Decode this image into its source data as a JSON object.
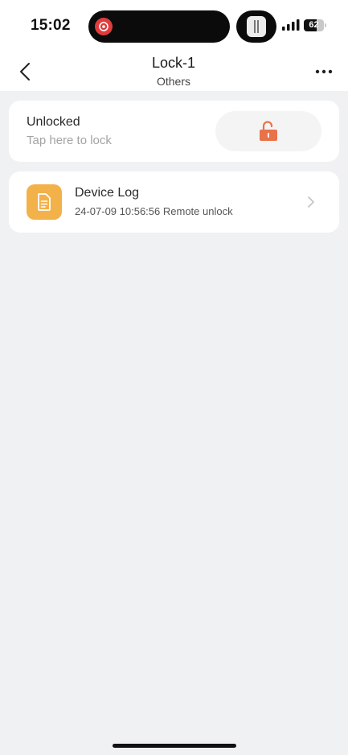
{
  "status_bar": {
    "time": "15:02",
    "battery_level": "62",
    "battery_fraction": 0.62
  },
  "header": {
    "title": "Lock-1",
    "subtitle": "Others"
  },
  "lock_card": {
    "status": "Unlocked",
    "hint": "Tap here to lock",
    "icon": "unlocked-padlock-icon",
    "icon_color": "#e8734a"
  },
  "device_log": {
    "title": "Device Log",
    "latest_entry": "24-07-09 10:56:56 Remote unlock",
    "icon": "document-icon",
    "icon_bg": "#f3b14a"
  },
  "colors": {
    "background": "#f0f1f3",
    "card": "#ffffff",
    "accent_orange": "#e8734a"
  }
}
